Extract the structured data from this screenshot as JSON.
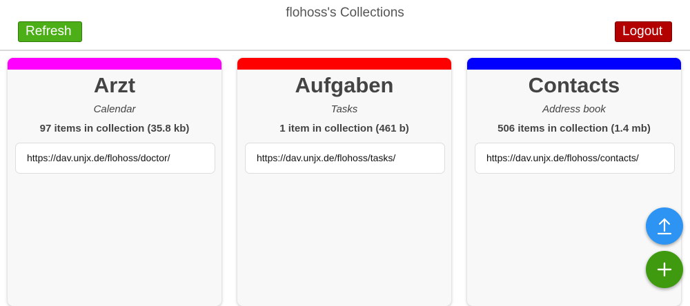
{
  "header": {
    "title": "flohoss's Collections",
    "refresh_label": "Refresh",
    "logout_label": "Logout"
  },
  "collections": [
    {
      "name": "Arzt",
      "type": "Calendar",
      "count": "97 items in collection (35.8 kb)",
      "url": "https://dav.unjx.de/flohoss/doctor/",
      "color": "#ff00ff"
    },
    {
      "name": "Aufgaben",
      "type": "Tasks",
      "count": "1 item in collection (461 b)",
      "url": "https://dav.unjx.de/flohoss/tasks/",
      "color": "#ff0000"
    },
    {
      "name": "Contacts",
      "type": "Address book",
      "count": "506 items in collection (1.4 mb)",
      "url": "https://dav.unjx.de/flohoss/contacts/",
      "color": "#0000ff"
    }
  ],
  "fabs": {
    "upload_icon": "upload-icon",
    "add_icon": "plus-icon",
    "upload_color": "#2e94f3",
    "add_color": "#3f9a10"
  }
}
